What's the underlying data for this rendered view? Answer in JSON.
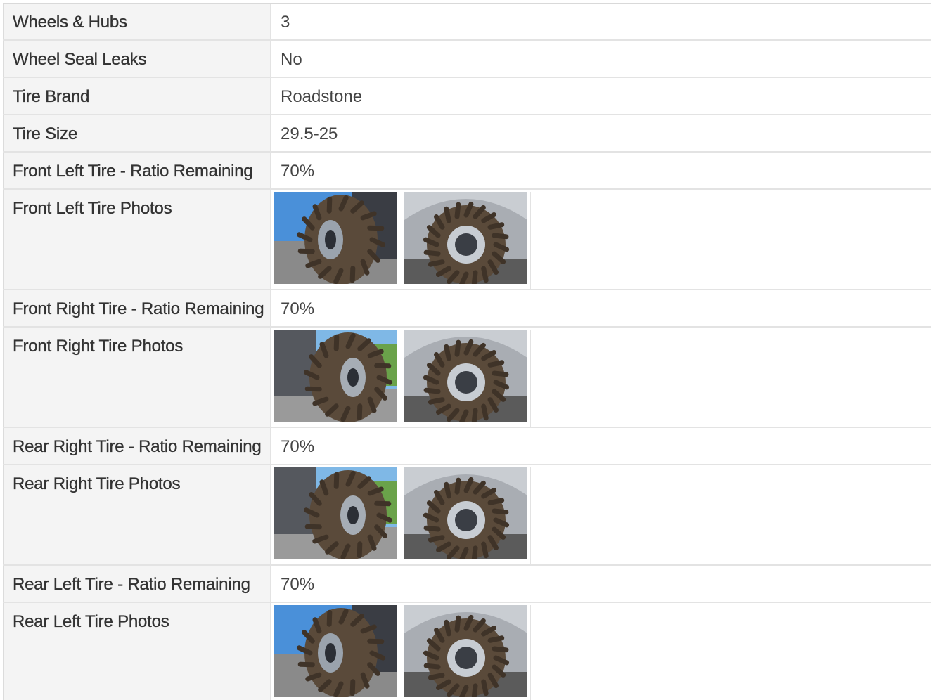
{
  "rows": [
    {
      "label": "Wheels & Hubs",
      "value": "3"
    },
    {
      "label": "Wheel Seal Leaks",
      "value": "No"
    },
    {
      "label": "Tire Brand",
      "value": "Roadstone"
    },
    {
      "label": "Tire Size",
      "value": "29.5-25"
    },
    {
      "label": "Front Left Tire - Ratio Remaining",
      "value": "70%"
    },
    {
      "label": "Front Left Tire Photos",
      "photos": [
        "tire-photo",
        "tire-photo"
      ]
    },
    {
      "label": "Front Right Tire - Ratio Remaining",
      "value": "70%"
    },
    {
      "label": "Front Right Tire Photos",
      "photos": [
        "tire-photo",
        "tire-photo"
      ]
    },
    {
      "label": "Rear Right Tire - Ratio Remaining",
      "value": "70%"
    },
    {
      "label": "Rear Right Tire Photos",
      "photos": [
        "tire-photo",
        "tire-photo"
      ]
    },
    {
      "label": "Rear Left Tire - Ratio Remaining",
      "value": "70%"
    },
    {
      "label": "Rear Left Tire Photos",
      "photos": [
        "tire-photo",
        "tire-photo"
      ]
    }
  ],
  "colors": {
    "label_bg": "#f4f4f4",
    "border": "#e3e3e3",
    "tire": "#5a4a3a",
    "sky": "#4a90d9",
    "ground": "#8a8a8a"
  }
}
